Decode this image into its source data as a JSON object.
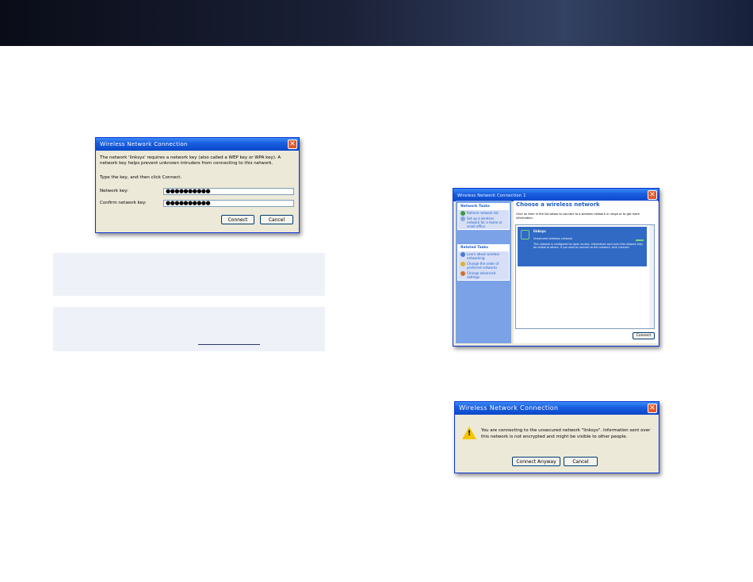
{
  "dialog_key": {
    "title": "Wireless Network Connection",
    "close": "✕",
    "message": "The network 'linksys' requires a network key (also called a WEP key or WPA key). A network key helps prevent unknown intruders from connecting to this network.",
    "instruction": "Type the key, and then click Connect.",
    "network_key_label": "Network key:",
    "network_key_value": "●●●●●●●●●●",
    "confirm_key_label": "Confirm network key:",
    "confirm_key_value": "●●●●●●●●●●",
    "connect_label": "Connect",
    "cancel_label": "Cancel"
  },
  "dialog_choose": {
    "title": "Wireless Network Connection 1",
    "close": "✕",
    "network_tasks_header": "Network Tasks",
    "tasks": [
      "Refresh network list",
      "Set up a wireless network for a home or small office"
    ],
    "related_tasks_header": "Related Tasks",
    "related": [
      "Learn about wireless networking",
      "Change the order of preferred networks",
      "Change advanced settings"
    ],
    "heading": "Choose a wireless network",
    "instruction": "Click an item in the list below to connect to a wireless network in range or to get more information.",
    "network_name": "linksys",
    "network_status": "Unsecured wireless network",
    "network_desc": "This network is configured for open access. Information sent over this network may be visible to others. If you want to connect to this network, click Connect.",
    "connect_label": "Connect"
  },
  "dialog_unsecured": {
    "title": "Wireless Network Connection",
    "close": "✕",
    "message": "You are connecting to the unsecured network \"linksys\". Information sent over this network is not encrypted and might be visible to other people.",
    "connect_anyway_label": "Connect Anyway",
    "cancel_label": "Cancel"
  },
  "colors": {
    "header_band": "#1a2036",
    "note_background": "#eef1f7",
    "xp_title": "#0a47c9",
    "xp_face": "#ece9d8",
    "selected_network": "#316ac5"
  }
}
